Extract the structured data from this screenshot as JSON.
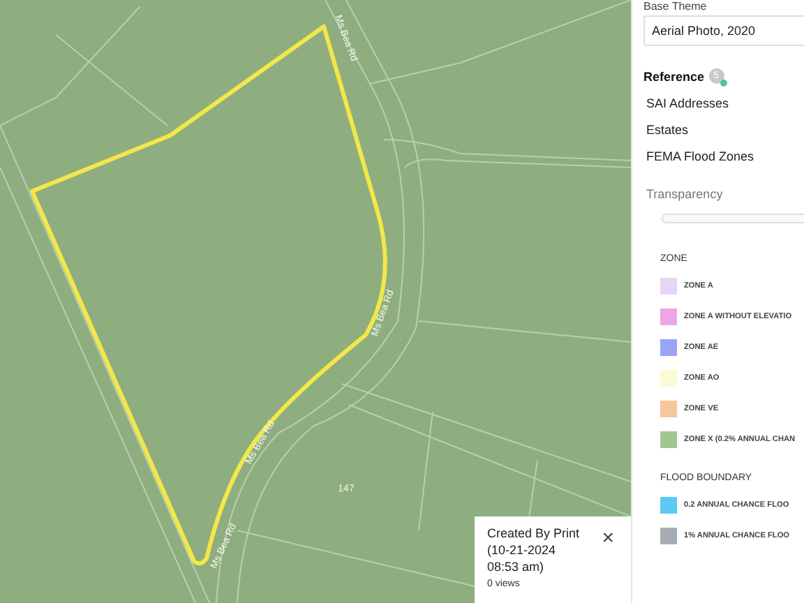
{
  "map": {
    "road_labels": [
      "Ms Bea Rd",
      "Ms Bea Rd",
      "Ms Bea Rd",
      "Ms Bea Rd"
    ],
    "parcel_label": "147"
  },
  "popup": {
    "title": "Created By Print (10-21-2024 08:53 am)",
    "views": "0 views",
    "close": "×"
  },
  "panel": {
    "base_theme": {
      "heading": "Base Theme",
      "value": "Aerial Photo, 2020"
    },
    "reference": {
      "heading": "Reference",
      "count": "5",
      "items": [
        "SAI Addresses",
        "Estates",
        "FEMA Flood Zones"
      ]
    },
    "transparency": {
      "label": "Transparency",
      "level": 0
    },
    "legend": [
      {
        "heading": "ZONE",
        "items": [
          {
            "label": "ZONE A",
            "color": "#e6d5f5"
          },
          {
            "label": "ZONE A WITHOUT ELEVATIO",
            "color": "#eea6e0"
          },
          {
            "label": "ZONE AE",
            "color": "#98a6f2"
          },
          {
            "label": "ZONE AO",
            "color": "#fdfbd2"
          },
          {
            "label": "ZONE VE",
            "color": "#f6c79c"
          },
          {
            "label": "ZONE X (0.2% ANNUAL CHAN",
            "color": "#a3c592"
          }
        ]
      },
      {
        "heading": "FLOOD BOUNDARY",
        "items": [
          {
            "label": "0.2 ANNUAL CHANCE FLOO",
            "color": "#5ccaf4"
          },
          {
            "label": "1% ANNUAL CHANCE FLOO",
            "color": "#a6acb3"
          }
        ]
      }
    ]
  }
}
